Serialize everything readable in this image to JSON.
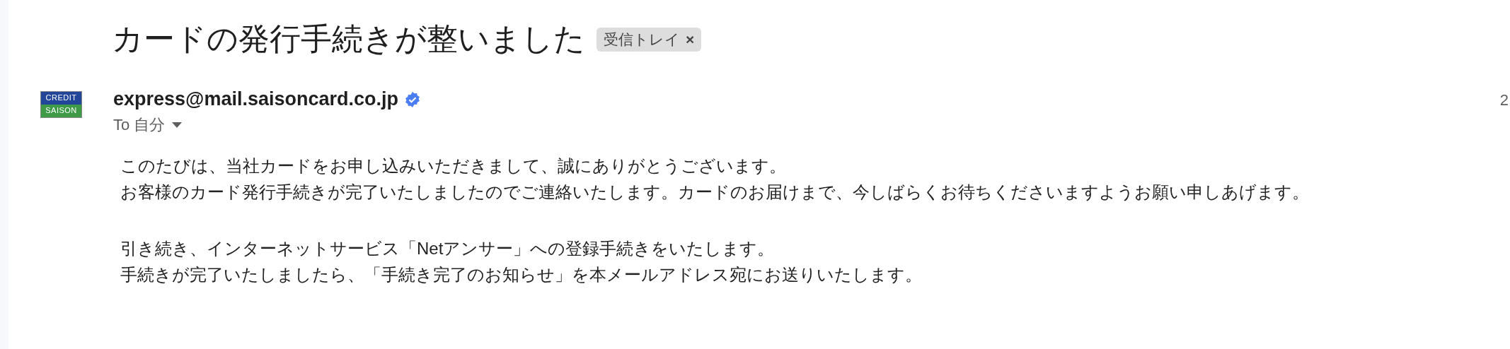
{
  "subject": {
    "title": "カードの発行手続きが整いました",
    "label": {
      "text": "受信トレイ",
      "close": "×"
    }
  },
  "sender": {
    "logo": {
      "top": "CREDIT",
      "bottom": "SAISON"
    },
    "address": "express@mail.saisoncard.co.jp",
    "verified": true,
    "recipient": "To 自分",
    "date": "2"
  },
  "body": [
    {
      "lines": [
        "このたびは、当社カードをお申し込みいただきまして、誠にありがとうございます。",
        "お客様のカード発行手続きが完了いたしましたのでご連絡いたします。カードのお届けまで、今しばらくお待ちくださいますようお願い申しあげます。"
      ]
    },
    {
      "lines": [
        "引き続き、インターネットサービス「Netアンサー」への登録手続きをいたします。",
        "手続きが完了いたしましたら、「手続き完了のお知らせ」を本メールアドレス宛にお送りいたします。"
      ]
    }
  ]
}
